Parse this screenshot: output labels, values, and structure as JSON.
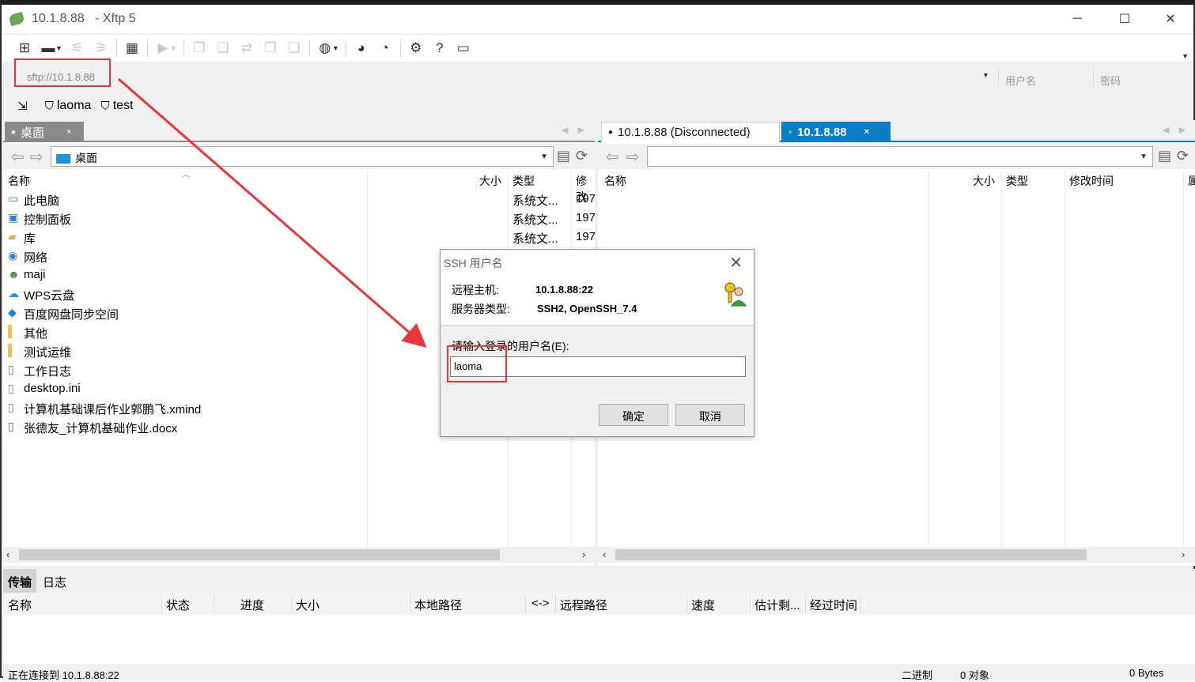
{
  "window": {
    "title_host": "10.1.8.88",
    "title_app": "- Xftp 5",
    "minimize_glyph": "─",
    "maximize_glyph": "☐",
    "close_glyph": "✕"
  },
  "toolbar": {
    "icons": [
      "new-session-icon",
      "open-folder-icon",
      "connect-icon",
      "disconnect-icon",
      "session-properties-icon",
      "transfer-icon",
      "copy-icon",
      "paste-icon",
      "refresh-icon",
      "copy2-icon",
      "paste2-icon",
      "globe-icon",
      "xshell-icon",
      "xftp-icon",
      "settings-icon",
      "help-icon",
      "chat-icon"
    ]
  },
  "address_bar": {
    "url": "sftp://10.1.8.88",
    "username_placeholder": "用户名",
    "password_placeholder": "密码"
  },
  "bookmarks": [
    {
      "label": "laoma"
    },
    {
      "label": "test"
    }
  ],
  "left_pane": {
    "tab_label": "桌面",
    "tab_close": "×",
    "path": "桌面",
    "columns": {
      "name": "名称",
      "size": "大小",
      "type": "类型",
      "modified": "修改"
    },
    "files": [
      {
        "name": "此电脑",
        "type": "系统文...",
        "modified": "197",
        "icon": "computer-icon"
      },
      {
        "name": "控制面板",
        "type": "系统文...",
        "modified": "197",
        "icon": "control-panel-icon"
      },
      {
        "name": "库",
        "type": "系统文...",
        "modified": "197",
        "icon": "library-icon"
      },
      {
        "name": "网络",
        "type": "",
        "modified": "",
        "icon": "network-icon"
      },
      {
        "name": "maji",
        "type": "",
        "modified": "",
        "icon": "user-folder-icon"
      },
      {
        "name": "WPS云盘",
        "type": "",
        "modified": "",
        "icon": "cloud-icon"
      },
      {
        "name": "百度网盘同步空间",
        "type": "",
        "modified": "",
        "icon": "baidu-icon"
      },
      {
        "name": "其他",
        "type": "",
        "modified": "",
        "icon": "folder-icon"
      },
      {
        "name": "测试运维",
        "type": "",
        "modified": "",
        "icon": "folder-shortcut-icon"
      },
      {
        "name": "工作日志",
        "type": "",
        "modified": "",
        "icon": "folder-shortcut-icon"
      },
      {
        "name": "desktop.ini",
        "type": "",
        "modified": "",
        "icon": "ini-file-icon"
      },
      {
        "name": "计算机基础课后作业郭鹏飞.xmind",
        "type": "",
        "modified": "",
        "icon": "file-icon"
      },
      {
        "name": "张德友_计算机基础作业.docx",
        "type": "",
        "modified": "",
        "icon": "word-file-icon"
      }
    ]
  },
  "right_pane": {
    "tab_disconnected": "10.1.8.88 (Disconnected)",
    "tab_active": "10.1.8.88",
    "tab_close": "×",
    "path": "",
    "columns": {
      "name": "名称",
      "size": "大小",
      "type": "类型",
      "modified": "修改时间",
      "attr": "属"
    }
  },
  "transfer": {
    "tabs": {
      "transfer": "传输",
      "log": "日志"
    },
    "columns": {
      "name": "名称",
      "status": "状态",
      "progress": "进度",
      "size": "大小",
      "local_path": "本地路径",
      "direction": "<->",
      "remote_path": "远程路径",
      "speed": "速度",
      "eta": "估计剩...",
      "elapsed": "经过时间"
    }
  },
  "status": {
    "message": "正在连接到 10.1.8.88:22",
    "mode": "二进制",
    "objects": "0 对象",
    "bytes": "0 Bytes"
  },
  "dialog": {
    "title": "SSH 用户名",
    "host_label": "远程主机:",
    "host_value": "10.1.8.88:22",
    "server_type_label": "服务器类型:",
    "server_type_value": "SSH2, OpenSSH_7.4",
    "prompt": "请输入登录的用户名(E):",
    "username_value": "laoma",
    "ok_label": "确定",
    "cancel_label": "取消"
  },
  "annotation_color": "#e8363b"
}
